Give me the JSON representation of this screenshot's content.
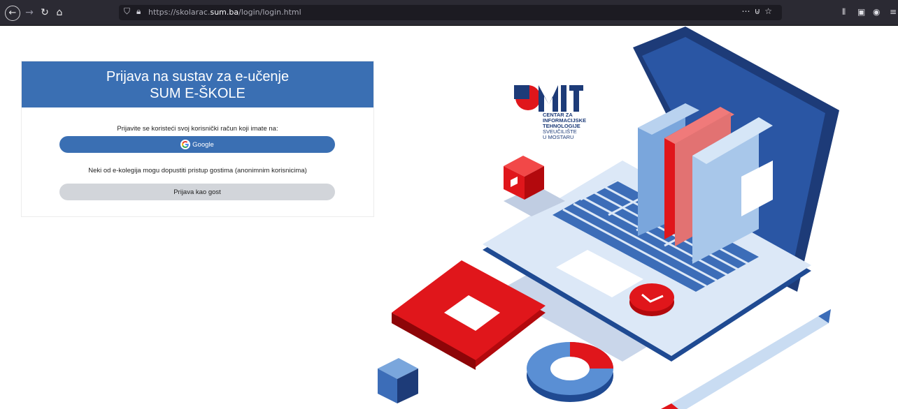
{
  "browser": {
    "url_prefix": "https://skolarac.",
    "url_domain": "sum.ba",
    "url_path": "/login/login.html",
    "icons": [
      "back-icon",
      "forward-icon",
      "reload-icon",
      "home-icon",
      "shield-icon",
      "lock-icon",
      "more-icon",
      "pocket-icon",
      "star-icon",
      "library-icon",
      "sidebar-icon",
      "account-icon",
      "menu-icon"
    ]
  },
  "login": {
    "title": "Prijava na sustav za e-učenje",
    "subtitle": "SUM E-ŠKOLE",
    "intro": "Prijavite se koristeći svoj korisnički račun koji imate na:",
    "google_label": "Google",
    "guest_intro": "Neki od e-kolegija mogu dopustiti pristup gostima (anonimnim korisnicima)",
    "guest_label": "Prijava kao gost"
  },
  "logo": {
    "mark": "SUMIT",
    "line1": "CENTAR ZA",
    "line2": "INFORMACIJSKE",
    "line3": "TEHNOLOGIJE",
    "line4": "SVEUČILIŠTE",
    "line5": "U MOSTARU"
  },
  "colors": {
    "brand_blue": "#3a6fb3",
    "dark_navy": "#1d3b78",
    "red": "#e0161b",
    "light_blue": "#c9dcf2"
  }
}
